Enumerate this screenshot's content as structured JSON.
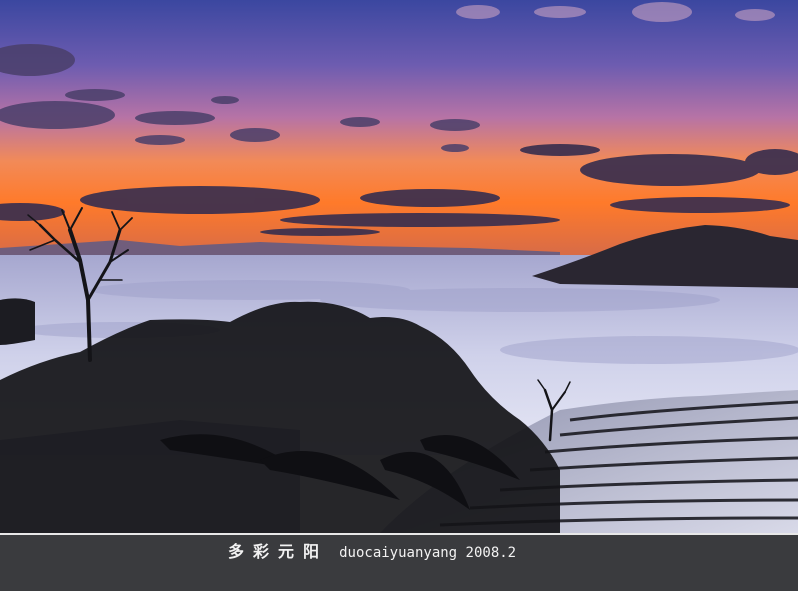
{
  "photo": {
    "subject": "Sunrise over a sea of clouds above terraced rice fields",
    "colors": {
      "sky_top": "#3c4aa0",
      "sky_mid": "#8a5fa8",
      "sky_glow": "#f08a4a",
      "horizon": "#ff6a2a",
      "cloud_sea": "#c9cde6",
      "silhouette": "#141418",
      "mountain": "#2a2630"
    }
  },
  "caption": {
    "chinese_title": "多彩元阳",
    "english_text": "duocaiyuanyang 2008.2",
    "bar_color": "#3a3b3e",
    "text_color": "#f2f2f2"
  }
}
